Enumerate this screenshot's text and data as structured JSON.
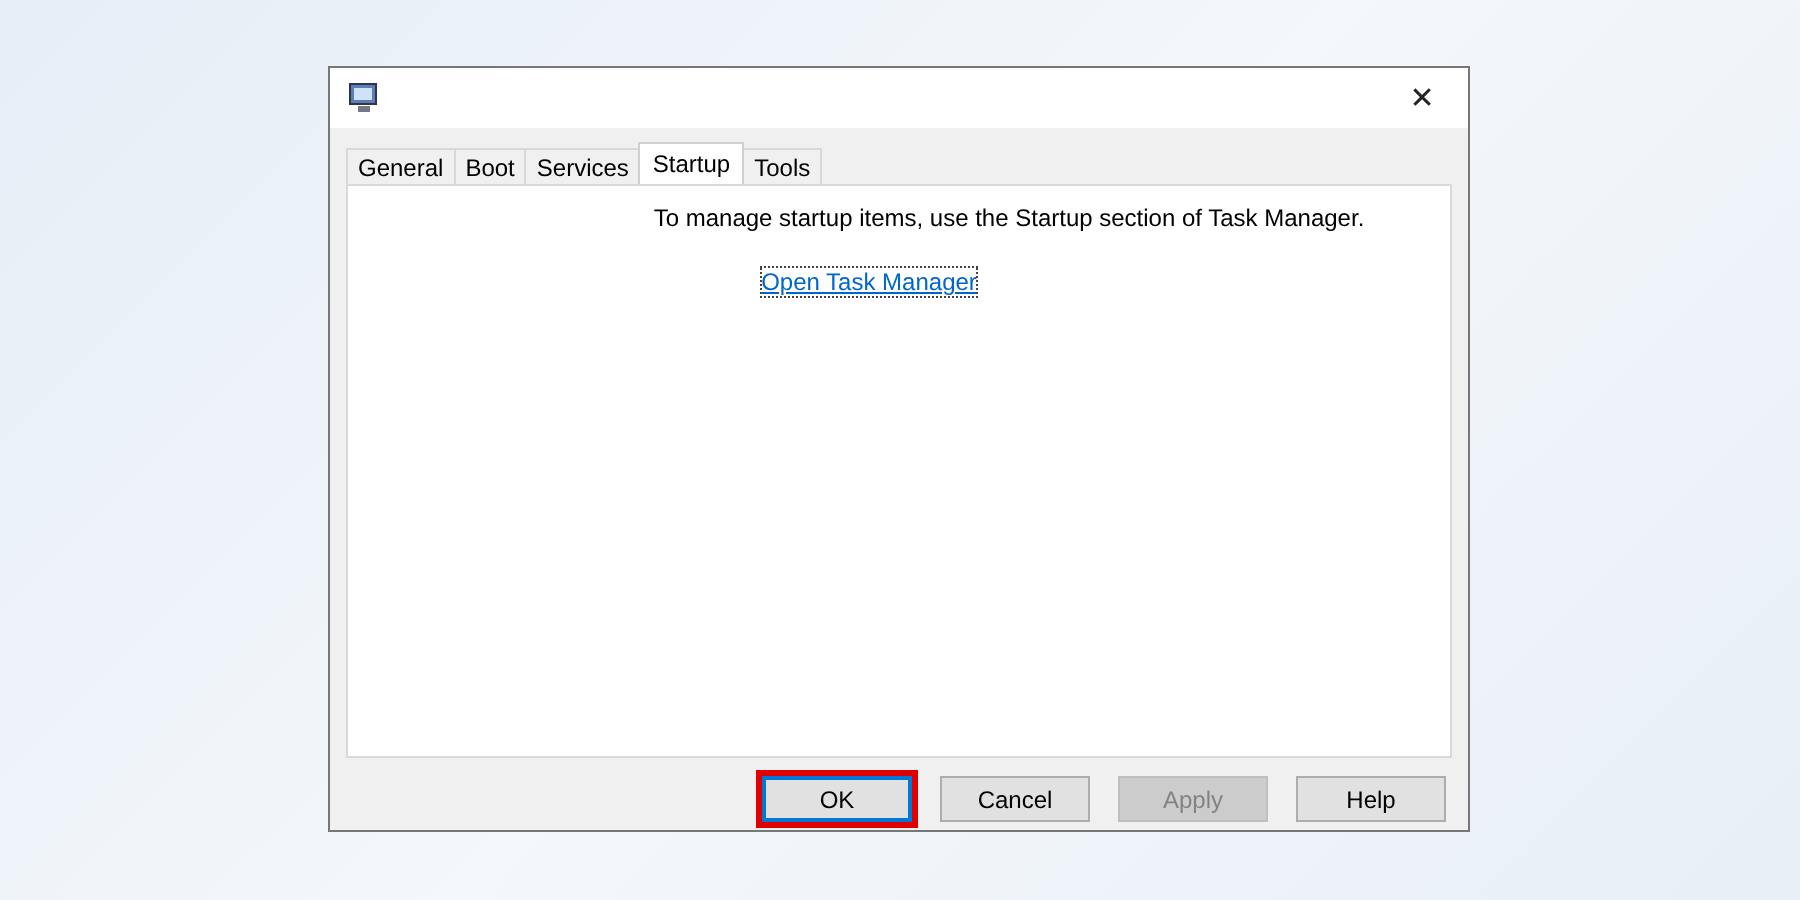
{
  "window": {
    "close_glyph": "✕"
  },
  "tabs": [
    {
      "label": "General",
      "selected": false
    },
    {
      "label": "Boot",
      "selected": false
    },
    {
      "label": "Services",
      "selected": false
    },
    {
      "label": "Startup",
      "selected": true
    },
    {
      "label": "Tools",
      "selected": false
    }
  ],
  "panel": {
    "message": "To manage startup items, use the Startup section of Task Manager.",
    "link": "Open Task Manager"
  },
  "buttons": [
    {
      "label": "OK",
      "disabled": false,
      "focused": true,
      "highlighted": true
    },
    {
      "label": "Cancel",
      "disabled": false,
      "focused": false,
      "highlighted": false
    },
    {
      "label": "Apply",
      "disabled": true,
      "focused": false,
      "highlighted": false
    },
    {
      "label": "Help",
      "disabled": false,
      "focused": false,
      "highlighted": false
    }
  ]
}
